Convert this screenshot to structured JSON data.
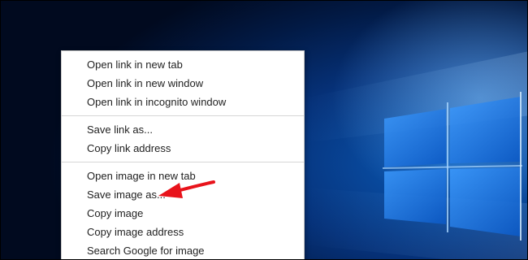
{
  "context_menu": {
    "groups": [
      [
        "Open link in new tab",
        "Open link in new window",
        "Open link in incognito window"
      ],
      [
        "Save link as...",
        "Copy link address"
      ],
      [
        "Open image in new tab",
        "Save image as...",
        "Copy image",
        "Copy image address",
        "Search Google for image"
      ]
    ]
  },
  "annotation": {
    "icon": "red-arrow-icon",
    "color": "#e8131b",
    "points_to": "Save image as..."
  },
  "colors": {
    "desktop_blue": "#0a5bb8",
    "menu_bg": "#ffffff",
    "separator": "#d6d6d6"
  }
}
